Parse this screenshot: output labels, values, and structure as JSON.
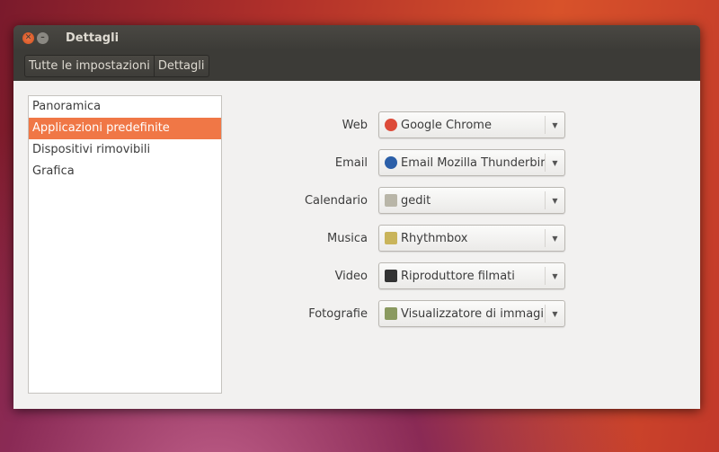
{
  "window": {
    "title": "Dettagli"
  },
  "breadcrumb": [
    "Tutte le impostazioni",
    "Dettagli"
  ],
  "sidebar": {
    "items": [
      {
        "label": "Panoramica"
      },
      {
        "label": "Applicazioni predefinite",
        "selected": true
      },
      {
        "label": "Dispositivi rimovibili"
      },
      {
        "label": "Grafica"
      }
    ]
  },
  "defaults": [
    {
      "label": "Web",
      "value": "Google Chrome",
      "icon": "chrome-icon",
      "color": "#dd4b39"
    },
    {
      "label": "Email",
      "value": "Email Mozilla Thunderbird",
      "icon": "thunderbird-icon",
      "color": "#2b5fa8"
    },
    {
      "label": "Calendario",
      "value": "gedit",
      "icon": "gedit-icon",
      "color": "#b9b6a8"
    },
    {
      "label": "Musica",
      "value": "Rhythmbox",
      "icon": "rhythmbox-icon",
      "color": "#c9b45a"
    },
    {
      "label": "Video",
      "value": "Riproduttore filmati",
      "icon": "movie-player-icon",
      "color": "#333333"
    },
    {
      "label": "Fotografie",
      "value": "Visualizzatore di immagini",
      "icon": "image-viewer-icon",
      "color": "#8a9a60"
    }
  ]
}
